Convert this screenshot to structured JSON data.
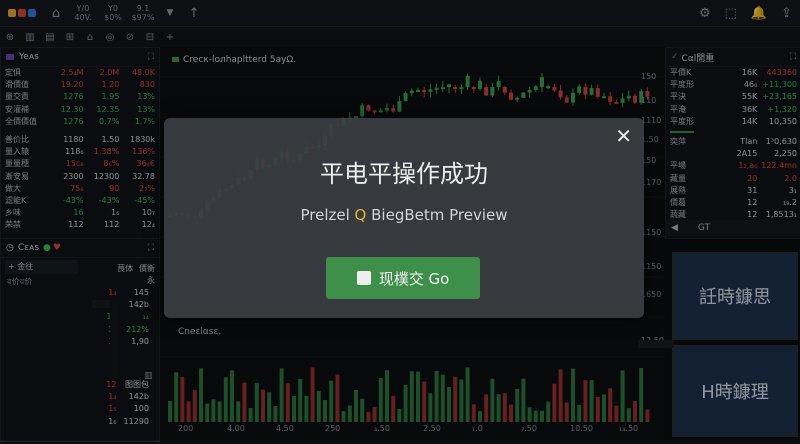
{
  "top_bar": {
    "stats": [
      {
        "line1": "Y/0",
        "line2": "40V."
      },
      {
        "line1": "Y0",
        "line2": "$0%"
      },
      {
        "line1": "9.1",
        "line2": "$97%"
      }
    ]
  },
  "toolbar2": {
    "items": [
      "⊕",
      "▥",
      "▤",
      "⊞",
      "⌂",
      "◎",
      "⊘",
      "⊟",
      "+"
    ]
  },
  "left_panel": {
    "title": "Yeᴀs",
    "rows": [
      {
        "c": [
          "定俱",
          "2.5₄M",
          "2.0M",
          "48.0K"
        ],
        "colors": [
          "",
          "red",
          "red",
          "red"
        ]
      },
      {
        "c": [
          "滑價值",
          "19.20",
          "1.20",
          "830"
        ],
        "colors": [
          "",
          "red",
          "red",
          "red"
        ]
      },
      {
        "c": [
          "量交責",
          "1276",
          "1.95",
          "13%"
        ],
        "colors": [
          "",
          "green",
          "green",
          "green"
        ]
      },
      {
        "c": [
          "安灌補",
          "12.30",
          "12.35",
          "13%"
        ],
        "colors": [
          "",
          "green",
          "green",
          "green"
        ]
      },
      {
        "c": [
          "全價價值",
          "1276",
          "0.7%",
          "1.7%"
        ],
        "colors": [
          "",
          "green",
          "green",
          "green"
        ]
      }
    ],
    "rows2": [
      {
        "c": [
          "善价比",
          "1180",
          "1.50",
          "1830k"
        ],
        "colors": [
          "",
          "white",
          "white",
          "white"
        ]
      },
      {
        "c": [
          "量入辕",
          "118₆",
          "1.38%",
          "136%"
        ],
        "colors": [
          "",
          "white",
          "red",
          "red"
        ]
      },
      {
        "c": [
          "量量穗",
          "15c₈",
          "8₆%",
          "36₄€"
        ],
        "colors": [
          "",
          "red",
          "red",
          "red"
        ]
      },
      {
        "c": [
          "漸安易",
          "2300",
          "12300",
          "32.78"
        ],
        "colors": [
          "",
          "white",
          "white",
          "white"
        ]
      },
      {
        "c": [
          "做大",
          "75₆",
          "90",
          "2₇%"
        ],
        "colors": [
          "",
          "red",
          "red",
          "red"
        ]
      },
      {
        "c": [
          "滤能K",
          "-43%",
          "-43%",
          "-45%"
        ],
        "colors": [
          "",
          "green",
          "green",
          "green"
        ]
      },
      {
        "c": [
          "乡味",
          "16",
          "1₆",
          "10₇"
        ],
        "colors": [
          "",
          "green",
          "white",
          "white"
        ]
      },
      {
        "c": [
          "荣禁",
          "112",
          "112",
          "12₄"
        ],
        "colors": [
          "",
          "white",
          "white",
          "white"
        ]
      }
    ]
  },
  "left_panel2": {
    "title": "Cεᴀs",
    "input": "+ 金往",
    "subtitle": "ৱ价ৱ价",
    "cols": [
      "茛体",
      "價衡永"
    ],
    "rows": [
      {
        "c": [
          "",
          "1₄",
          "145"
        ],
        "colors": [
          "",
          "red",
          "white"
        ]
      },
      {
        "c": [
          "",
          "1₄",
          "142b"
        ],
        "colors": [
          "",
          "red",
          "white"
        ]
      },
      {
        "c": [
          "",
          "19",
          "₁₄"
        ],
        "colors": [
          "",
          "green",
          "green"
        ]
      },
      {
        "c": [
          "",
          "3₉",
          "212%"
        ],
        "colors": [
          "",
          "green",
          "green"
        ]
      },
      {
        "c": [
          "",
          "3₂",
          "1,90"
        ],
        "colors": [
          "",
          "red",
          "white"
        ]
      }
    ],
    "bottom_rows": [
      {
        "c": [
          "",
          "12",
          "图图包"
        ],
        "colors": [
          "",
          "red",
          "white"
        ]
      },
      {
        "c": [
          "",
          "1₄",
          "142b"
        ],
        "colors": [
          "",
          "red",
          "white"
        ]
      },
      {
        "c": [
          "",
          "1₅",
          "100"
        ],
        "colors": [
          "",
          "red",
          "white"
        ]
      },
      {
        "c": [
          "",
          "1₆",
          "11290"
        ],
        "colors": [
          "",
          "white",
          "white"
        ]
      }
    ]
  },
  "chart": {
    "title": "Crecк-lолhaplttеrd 5ayΩ.",
    "right_axis": [
      "150",
      "110",
      "1110",
      "1.50",
      "150",
      "1170",
      "1150",
      "1150",
      "1650",
      "12.50"
    ],
    "lower_title": "Cneεlαsε.",
    "x_labels": [
      "200",
      "4.00",
      "4.50",
      "250",
      "₄.50",
      "2.50",
      "₁.0",
      "₇.50",
      "10.50",
      "₁₄.50"
    ]
  },
  "right_panel": {
    "title": "Cαl閒重",
    "rows": [
      {
        "c": [
          "平價K",
          "16K",
          "443360"
        ],
        "colors": [
          "",
          "white",
          "red"
        ]
      },
      {
        "c": [
          "平度形",
          "46₀",
          "+11,300"
        ],
        "colors": [
          "",
          "white",
          "green"
        ]
      },
      {
        "c": [
          "平決",
          "55K",
          "+23,165"
        ],
        "colors": [
          "",
          "white",
          "green"
        ]
      },
      {
        "c": [
          "平淹",
          "36K",
          "+1,320"
        ],
        "colors": [
          "",
          "white",
          "green"
        ]
      },
      {
        "c": [
          "平度形",
          "14K",
          "10,350"
        ],
        "colors": [
          "",
          "white",
          "white"
        ]
      }
    ],
    "rows2": [
      {
        "c": [
          "奕萍",
          "Tlan",
          "1³0,630"
        ],
        "colors": [
          "",
          "white",
          "white"
        ]
      },
      {
        "c": [
          "",
          "2A15",
          "2,250"
        ],
        "colors": [
          "",
          "white",
          "white"
        ]
      },
      {
        "c": [
          "平場",
          "1₂,a₆",
          "122.4mn"
        ],
        "colors": [
          "",
          "red",
          "red"
        ]
      },
      {
        "c": [
          "藏量",
          "20",
          "2.0"
        ],
        "colors": [
          "",
          "red",
          "red"
        ]
      },
      {
        "c": [
          "展熟",
          "31",
          "3₁"
        ],
        "colors": [
          "",
          "white",
          "white"
        ]
      },
      {
        "c": [
          "價葛",
          "12",
          "₁₈.2"
        ],
        "colors": [
          "",
          "white",
          "white"
        ]
      },
      {
        "c": [
          "蔬藏",
          "12",
          "1,8513₁"
        ],
        "colors": [
          "",
          "white",
          "white"
        ]
      }
    ],
    "footer": "GT"
  },
  "monitors": [
    {
      "text": "䚾時鏮思"
    },
    {
      "text": "H時鏮理"
    }
  ],
  "modal": {
    "title": "平电平操作成功",
    "subtitle_pre": "Prelzel",
    "subtitle_icon": "Q",
    "subtitle_post": "BiegBetm Preview",
    "button": "现樸交 Go",
    "close": "✕"
  }
}
